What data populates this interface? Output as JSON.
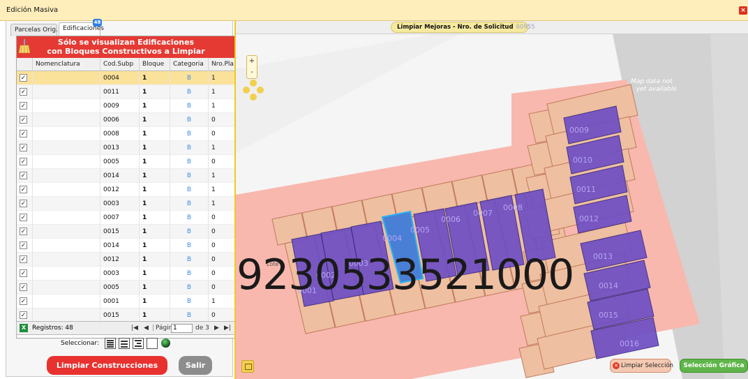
{
  "window": {
    "title": "Edición Masiva",
    "close_icon": "close-icon"
  },
  "tabs": [
    {
      "label": "Parcelas Orig."
    },
    {
      "label": "Edificaciones",
      "badge": "48"
    }
  ],
  "grid": {
    "banner_line1": "Sólo se visualizan Edificaciones",
    "banner_line2": "con Bloques Constructivos a Limpiar",
    "columns": [
      "",
      "Nomenclatura",
      "Cod.Subp",
      "Bloque",
      "Categoria",
      "Nro.Pla"
    ],
    "rows": [
      {
        "checked": true,
        "nomenclatura": "",
        "cod": "0004",
        "bloque": "1",
        "categoria": "B",
        "nro": "1"
      },
      {
        "checked": true,
        "nomenclatura": "",
        "cod": "0011",
        "bloque": "1",
        "categoria": "B",
        "nro": "1"
      },
      {
        "checked": true,
        "nomenclatura": "",
        "cod": "0009",
        "bloque": "1",
        "categoria": "B",
        "nro": "1"
      },
      {
        "checked": true,
        "nomenclatura": "",
        "cod": "0006",
        "bloque": "1",
        "categoria": "B",
        "nro": "0"
      },
      {
        "checked": true,
        "nomenclatura": "",
        "cod": "0008",
        "bloque": "1",
        "categoria": "B",
        "nro": "0"
      },
      {
        "checked": true,
        "nomenclatura": "",
        "cod": "0013",
        "bloque": "1",
        "categoria": "B",
        "nro": "1"
      },
      {
        "checked": true,
        "nomenclatura": "",
        "cod": "0005",
        "bloque": "1",
        "categoria": "B",
        "nro": "0"
      },
      {
        "checked": true,
        "nomenclatura": "",
        "cod": "0014",
        "bloque": "1",
        "categoria": "B",
        "nro": "1"
      },
      {
        "checked": true,
        "nomenclatura": "",
        "cod": "0012",
        "bloque": "1",
        "categoria": "B",
        "nro": "1"
      },
      {
        "checked": true,
        "nomenclatura": "",
        "cod": "0003",
        "bloque": "1",
        "categoria": "B",
        "nro": "1"
      },
      {
        "checked": true,
        "nomenclatura": "",
        "cod": "0007",
        "bloque": "1",
        "categoria": "B",
        "nro": "0"
      },
      {
        "checked": true,
        "nomenclatura": "",
        "cod": "0015",
        "bloque": "1",
        "categoria": "B",
        "nro": "0"
      },
      {
        "checked": true,
        "nomenclatura": "",
        "cod": "0014",
        "bloque": "1",
        "categoria": "B",
        "nro": "0"
      },
      {
        "checked": true,
        "nomenclatura": "",
        "cod": "0012",
        "bloque": "1",
        "categoria": "B",
        "nro": "0"
      },
      {
        "checked": true,
        "nomenclatura": "",
        "cod": "0003",
        "bloque": "1",
        "categoria": "B",
        "nro": "0"
      },
      {
        "checked": true,
        "nomenclatura": "",
        "cod": "0005",
        "bloque": "1",
        "categoria": "B",
        "nro": "0"
      },
      {
        "checked": true,
        "nomenclatura": "",
        "cod": "0001",
        "bloque": "1",
        "categoria": "B",
        "nro": "1"
      },
      {
        "checked": true,
        "nomenclatura": "",
        "cod": "0015",
        "bloque": "1",
        "categoria": "B",
        "nro": "0"
      }
    ]
  },
  "pager": {
    "registros": "Registros: 48",
    "pagina_label": "Página",
    "pagina_value": "1",
    "de": "de 3"
  },
  "selector": {
    "label": "Seleccionar:"
  },
  "buttons": {
    "limpiar": "Limpiar Construcciones",
    "salir": "Salir",
    "limpiar_sel": "Limpiar Selección",
    "seleccion_grafica": "Selección Gráfica"
  },
  "map": {
    "header_title": "Limpiar Mejoras - Nro. de Solicitud",
    "header_number": "60955",
    "zoom_in": "+",
    "zoom_out": "-",
    "overlay_number": "9230533521000",
    "lote_label": "Lote 2",
    "no_data": [
      "Map data not",
      "yet available"
    ],
    "parcel_labels": [
      "0009",
      "0010",
      "0011",
      "0012",
      "0013",
      "0014",
      "0015",
      "0016",
      "0008",
      "0007",
      "0006",
      "0005",
      "0004",
      "0003",
      "0002",
      "0001"
    ]
  },
  "colors": {
    "title_bg": "#fdeebc",
    "banner_red": "#e53a34",
    "selected_row": "#fbe29a",
    "building": "#6e4fc4",
    "parcel": "#eebfa0",
    "lot": "#f8b8ae",
    "selected_parcel": "#3c8ce6"
  }
}
